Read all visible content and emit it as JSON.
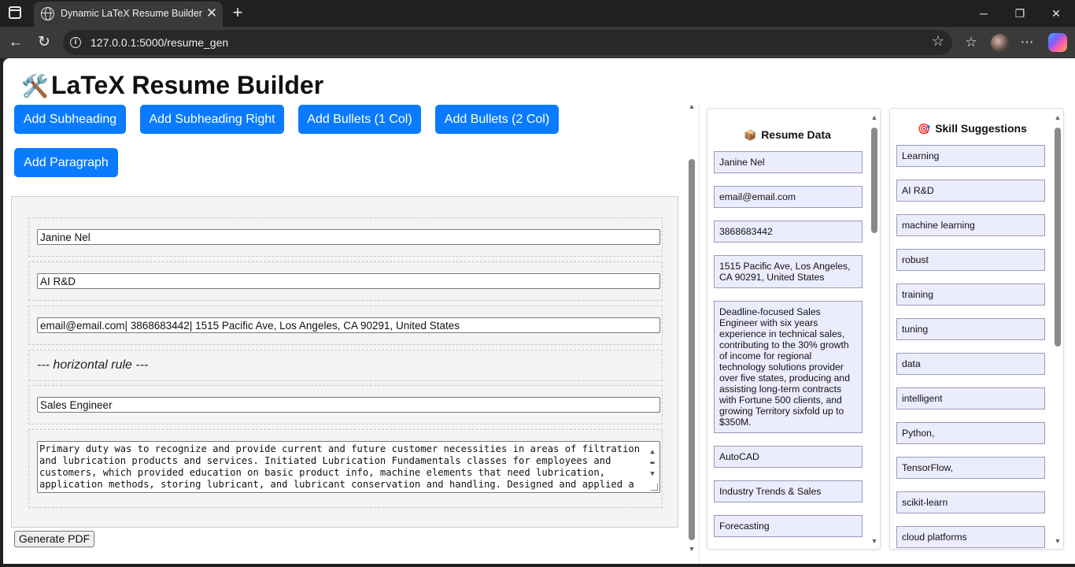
{
  "browser": {
    "tab_title": "Dynamic LaTeX Resume Builder",
    "url": "127.0.0.1:5000/resume_gen"
  },
  "page": {
    "title": "LaTeX Resume Builder",
    "buttons": {
      "add_subheading": "Add Subheading",
      "add_subheading_right": "Add Subheading Right",
      "add_bullets_1": "Add Bullets (1 Col)",
      "add_bullets_2": "Add Bullets (2 Col)",
      "add_paragraph": "Add Paragraph",
      "generate_pdf": "Generate PDF"
    },
    "blocks": {
      "name": "Janine Nel",
      "subtitle": "AI R&D",
      "contact": "email@email.com| 3868683442| 1515 Pacific Ave, Los Angeles, CA 90291, United States",
      "hr": "--- horizontal rule ---",
      "role": "Sales Engineer",
      "paragraph": "Primary duty was to recognize and provide current and future customer necessities in areas of filtration and lubrication products and services. Initiated Lubrication Fundamentals classes for employees and customers, which provided education on basic product info, machine elements that need lubrication, application methods, storing lubricant, and lubricant conservation and handling. Designed and applied a"
    }
  },
  "resume_panel": {
    "title": "Resume Data",
    "icon": "package-icon",
    "items": [
      "Janine Nel",
      "email@email.com",
      "3868683442",
      "1515 Pacific Ave, Los Angeles, CA 90291, United States",
      "Deadline-focused Sales Engineer with six years experience in technical sales, contributing to the 30% growth of income for regional technology solutions provider over five states, producing and assisting long-term contracts with Fortune 500 clients, and growing Territory sixfold up to $350M.",
      "AutoCAD",
      "Industry Trends & Sales",
      "Forecasting"
    ]
  },
  "skills_panel": {
    "title": "Skill Suggestions",
    "icon": "target-icon",
    "items": [
      "Learning",
      "AI R&D",
      "machine learning",
      "robust",
      "training",
      "tuning",
      "data",
      "intelligent",
      "Python,",
      "TensorFlow,",
      "scikit-learn",
      "cloud platforms"
    ]
  },
  "colors": {
    "button_blue": "#0a7bff",
    "card_bg": "#ececff",
    "card_border": "#9a9ab8"
  }
}
